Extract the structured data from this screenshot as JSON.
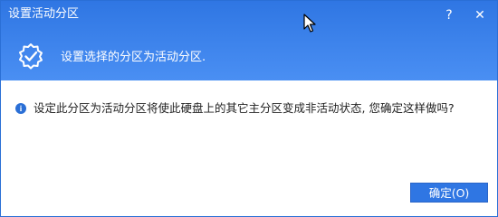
{
  "window": {
    "title": "设置活动分区",
    "help_label": "?",
    "close_label": "✕"
  },
  "header": {
    "message": "设置选择的分区为活动分区.",
    "icon": "gear-check-icon"
  },
  "body": {
    "info_icon": "info-icon",
    "info_text": "设定此分区为活动分区将使此硬盘上的其它主分区变成非活动状态, 您确定这样做吗?"
  },
  "footer": {
    "ok_label": "确定(O)"
  },
  "colors": {
    "header_top": "#2f76e3",
    "header_bottom": "#4a8ff3",
    "button": "#2f76e3",
    "info_icon": "#2a6fd6"
  }
}
